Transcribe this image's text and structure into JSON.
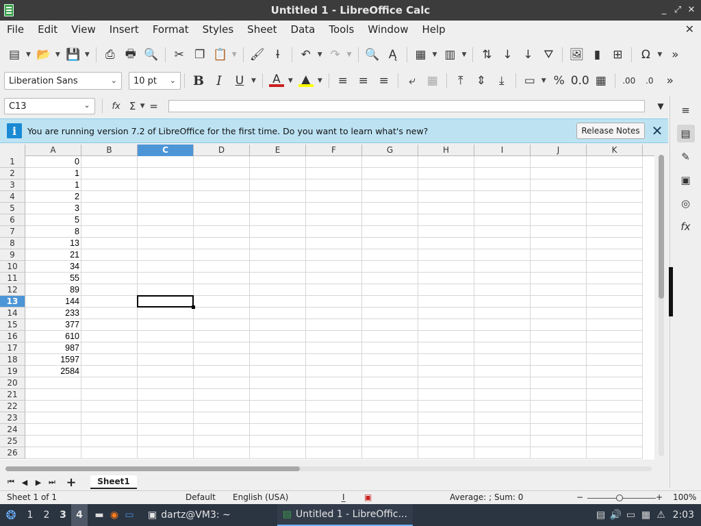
{
  "window": {
    "title": "Untitled 1 - LibreOffice Calc",
    "minimize": "_",
    "restore": "⤢",
    "close": "✕"
  },
  "menu": [
    "File",
    "Edit",
    "View",
    "Insert",
    "Format",
    "Styles",
    "Sheet",
    "Data",
    "Tools",
    "Window",
    "Help"
  ],
  "menu_close": "✕",
  "toolbar1": {
    "icons": [
      "new-icon",
      "open-icon",
      "save-icon",
      "export-pdf-icon",
      "print-icon",
      "print-preview-icon",
      "cut-icon",
      "copy-icon",
      "paste-icon",
      "clone-formatting-icon",
      "clear-formatting-icon",
      "undo-icon",
      "redo-icon",
      "find-replace-icon",
      "spelling-icon",
      "row-icon",
      "column-icon",
      "sort-icon",
      "sort-ascending-icon",
      "sort-descending-icon",
      "autofilter-icon",
      "insert-image-icon",
      "insert-chart-icon",
      "pivot-table-icon",
      "special-character-icon",
      "more-icon"
    ],
    "glyphs": {
      "new": "▤",
      "open": "📂",
      "save": "💾",
      "pdf": "⎙",
      "print": "🖶",
      "preview": "🔍",
      "cut": "✂",
      "copy": "❐",
      "paste": "📋",
      "clone": "🖌",
      "clear": "Ɨ",
      "undo": "↶",
      "redo": "↷",
      "find": "🔍",
      "spell": "Ą",
      "row": "▦",
      "col": "▥",
      "sort": "⇅",
      "asc": "↓",
      "desc": "↓",
      "filter": "⛛",
      "image": "🖼",
      "chart": "▮",
      "pivot": "⊞",
      "omega": "Ω",
      "more": "»"
    }
  },
  "toolbar2": {
    "font_name": "Liberation Sans",
    "font_size": "10 pt",
    "bold": "B",
    "italic": "I",
    "underline": "U",
    "font_color_glyph": "A",
    "font_color": "#c9211e",
    "highlight_glyph": "▲",
    "highlight_color": "#ffff00",
    "percent": "%",
    "more": "»"
  },
  "formula": {
    "cell_ref": "C13",
    "fx": "fx",
    "sum": "Σ",
    "equals": "=",
    "value": ""
  },
  "infobar": {
    "message": "You are running version 7.2 of LibreOffice for the first time. Do you want to learn what's new?",
    "button": "Release Notes",
    "close": "✕"
  },
  "columns": [
    "A",
    "B",
    "C",
    "D",
    "E",
    "F",
    "G",
    "H",
    "I",
    "J",
    "K"
  ],
  "selected_column": "C",
  "rows": [
    "1",
    "2",
    "3",
    "4",
    "5",
    "6",
    "7",
    "8",
    "9",
    "10",
    "11",
    "12",
    "13",
    "14",
    "15",
    "16",
    "17",
    "18",
    "19",
    "20",
    "21",
    "22",
    "23",
    "24",
    "25",
    "26"
  ],
  "selected_row": "13",
  "column_a_values": [
    "0",
    "1",
    "1",
    "2",
    "3",
    "5",
    "8",
    "13",
    "21",
    "34",
    "55",
    "89",
    "144",
    "233",
    "377",
    "610",
    "987",
    "1597",
    "2584"
  ],
  "sheet_tabs": [
    "Sheet1"
  ],
  "nav": {
    "first": "⏮",
    "prev": "◀",
    "next": "▶",
    "last": "⏭",
    "add": "+"
  },
  "status": {
    "sheet": "Sheet 1 of 1",
    "style": "Default",
    "language": "English (USA)",
    "summary": "Average: ; Sum: 0",
    "zoom": "100%",
    "zoom_minus": "−",
    "zoom_plus": "+"
  },
  "sidebar": [
    "properties-icon",
    "styles-icon",
    "gallery-icon",
    "navigator-icon",
    "functions-icon"
  ],
  "taskbar": {
    "workspaces": [
      "1",
      "2",
      "3",
      "4"
    ],
    "active_workspace": "4",
    "terminal": "dartz@VM3: ~",
    "calc": "Untitled 1 - LibreOffic...",
    "clock": "2:03"
  }
}
